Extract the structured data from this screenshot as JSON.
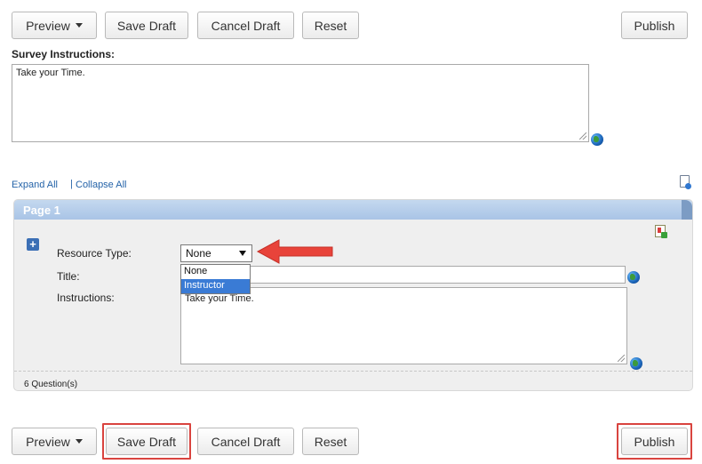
{
  "toolbar": {
    "preview_label": "Preview",
    "save_draft_label": "Save Draft",
    "cancel_draft_label": "Cancel Draft",
    "reset_label": "Reset",
    "publish_label": "Publish"
  },
  "survey": {
    "instructions_label": "Survey Instructions:",
    "instructions_value": "Take your Time."
  },
  "links": {
    "expand_all": "Expand All",
    "separator": "|",
    "collapse_all": "Collapse All"
  },
  "page": {
    "header": "Page 1",
    "resource_type_label": "Resource Type:",
    "resource_type_value": "None",
    "resource_type_options": [
      "None",
      "Instructor"
    ],
    "resource_type_selected_option": "Instructor",
    "title_label": "Title:",
    "title_value": "",
    "instructions_label": "Instructions:",
    "instructions_value": "Take your Time.",
    "question_count": "6 Question(s)"
  },
  "colors": {
    "highlight": "#d9443f",
    "link": "#2463a8",
    "page_header": "#a9c4e6",
    "selected_option": "#3a7bd5"
  }
}
